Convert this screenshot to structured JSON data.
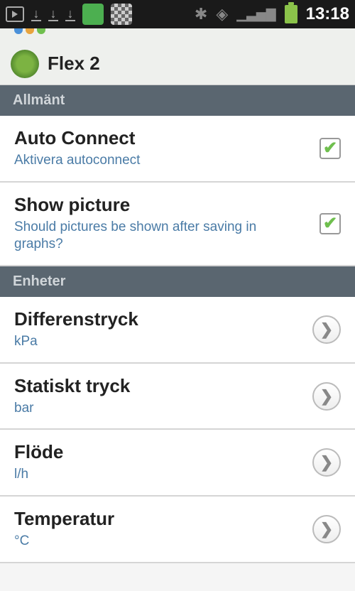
{
  "status": {
    "time": "13:18"
  },
  "header": {
    "title": "Flex 2"
  },
  "sections": {
    "general": {
      "label": "Allmänt",
      "auto_connect": {
        "title": "Auto Connect",
        "subtitle": "Aktivera autoconnect",
        "checked": true
      },
      "show_picture": {
        "title": "Show picture",
        "subtitle": "Should pictures be shown after saving in graphs?",
        "checked": true
      }
    },
    "units": {
      "label": "Enheter",
      "diff_pressure": {
        "title": "Differenstryck",
        "value": "kPa"
      },
      "static_pressure": {
        "title": "Statiskt tryck",
        "value": "bar"
      },
      "flow": {
        "title": "Flöde",
        "value": "l/h"
      },
      "temperature": {
        "title": "Temperatur",
        "value": "°C"
      }
    }
  }
}
